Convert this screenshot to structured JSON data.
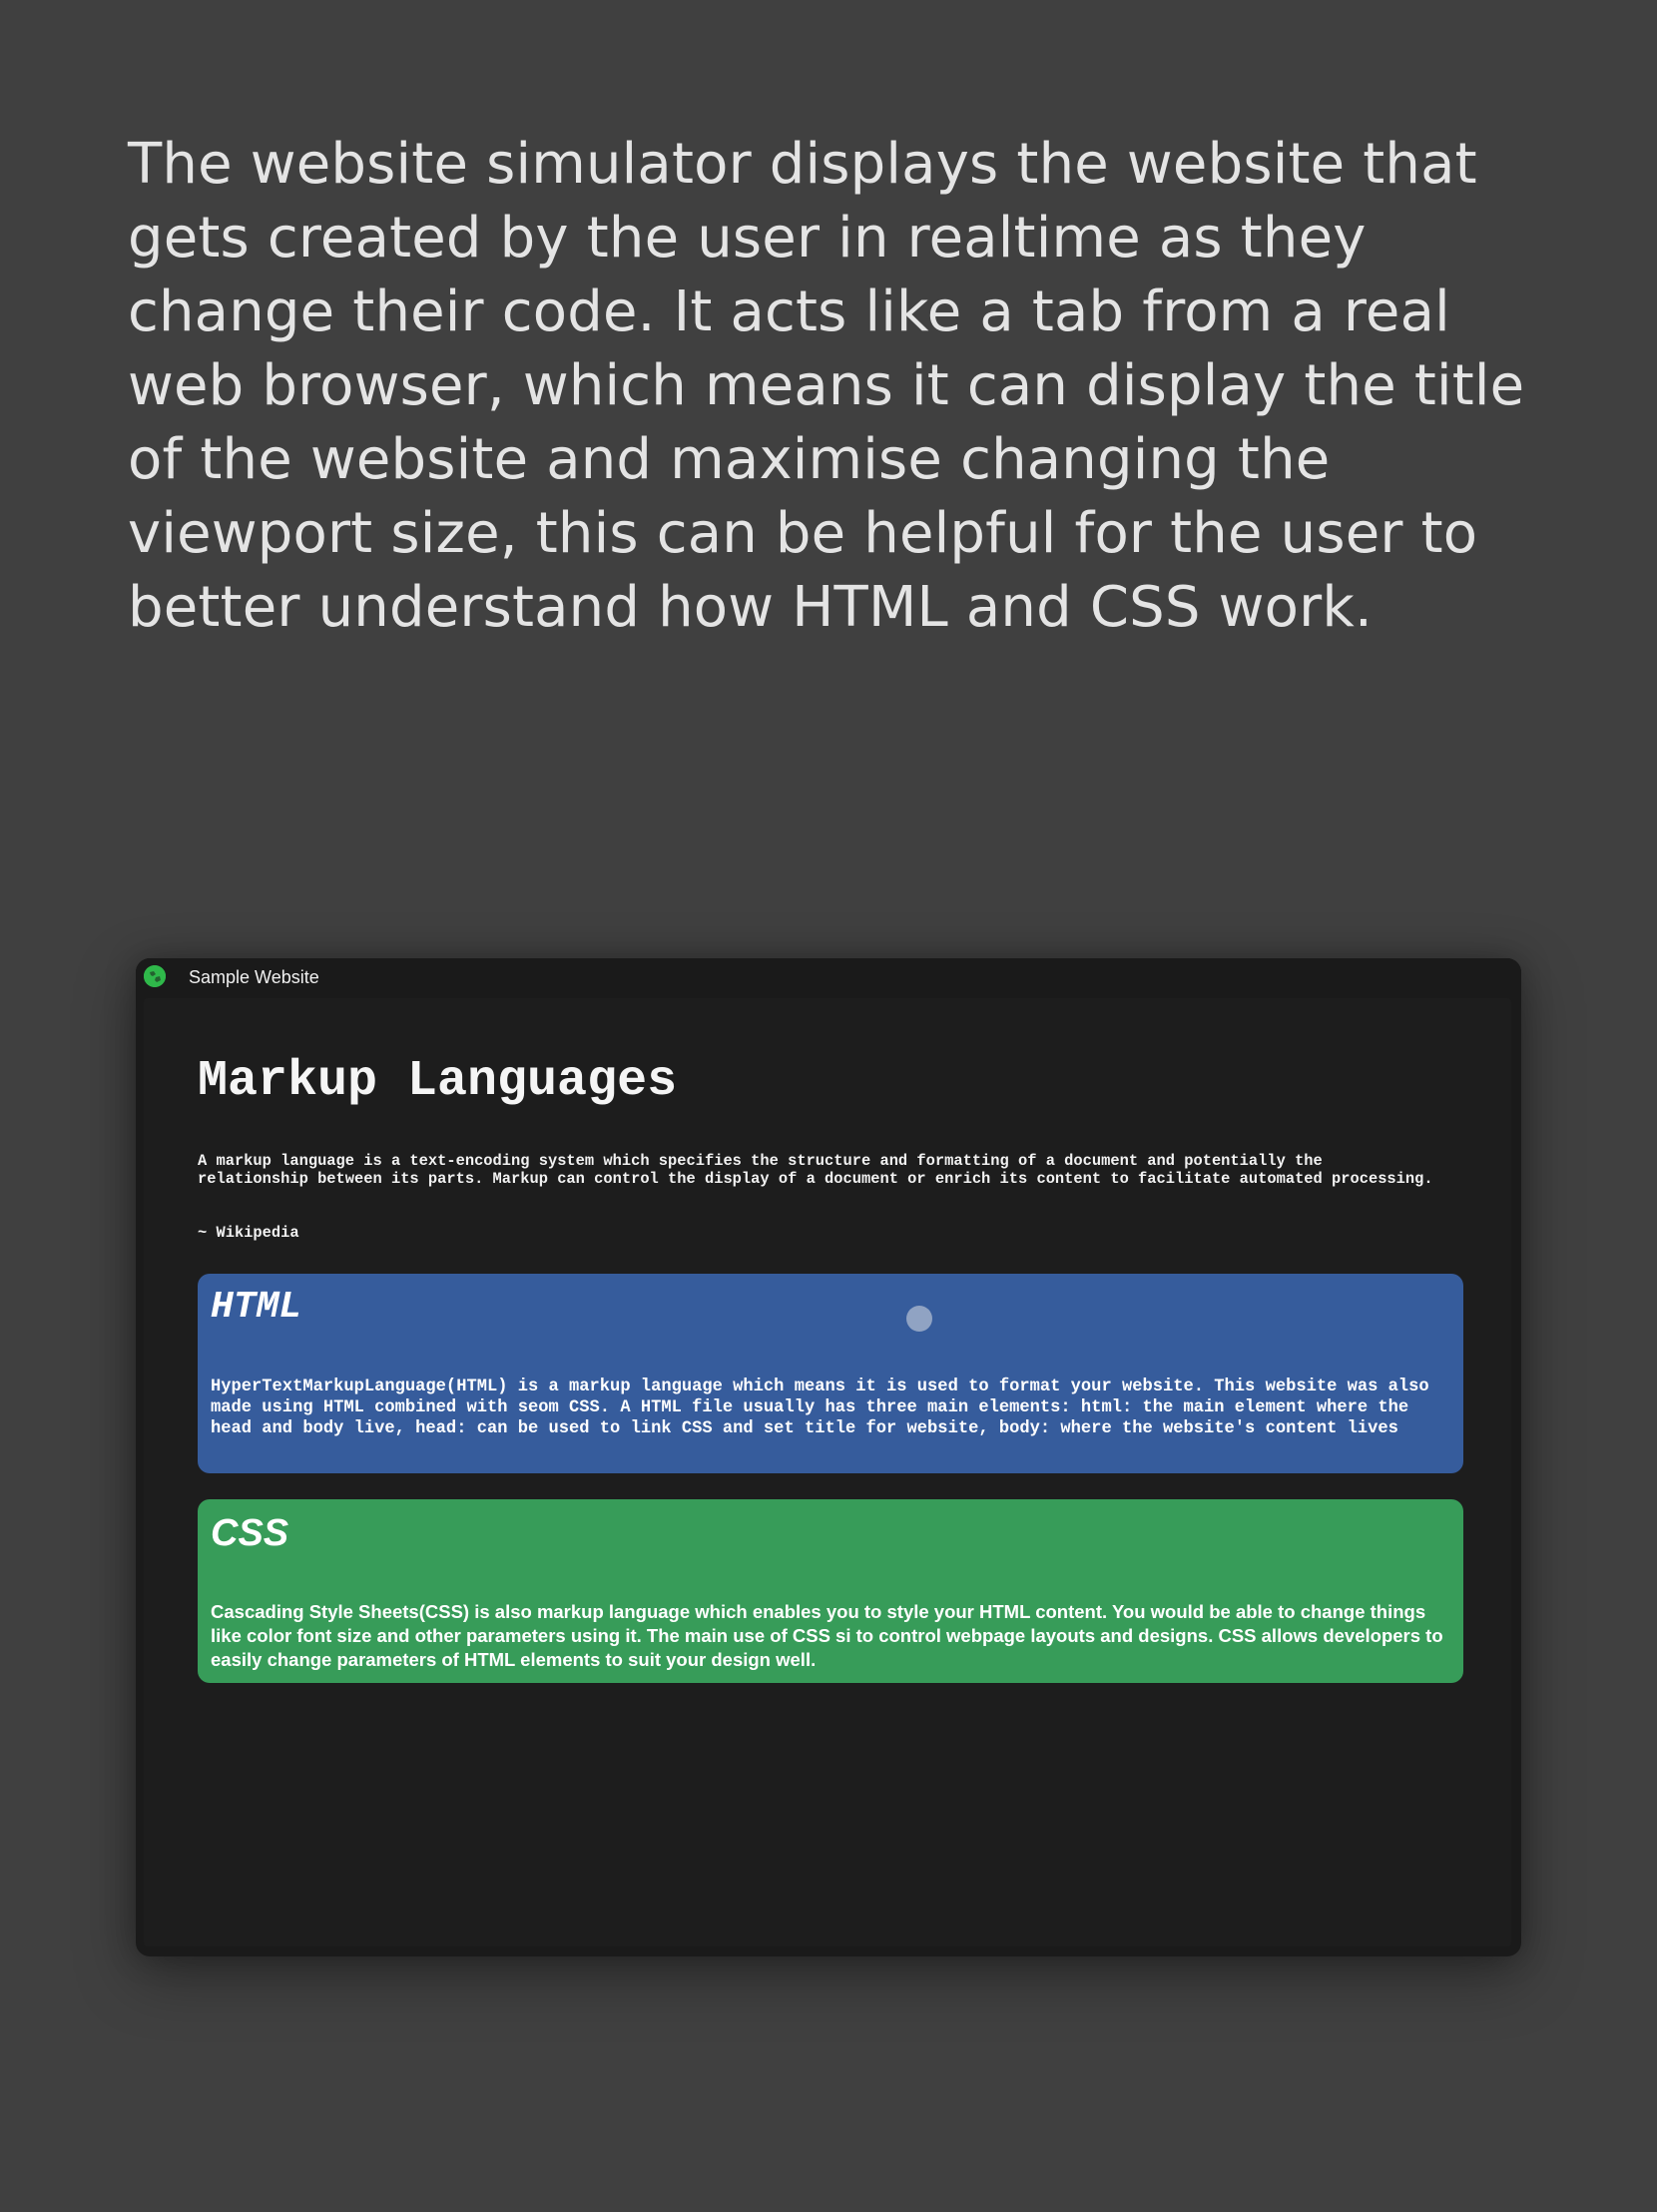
{
  "intro": {
    "text": "The website simulator displays the website that gets created by the user in realtime as they change their code. It acts like a tab from a real web browser, which means it can display the title of the website and maximise changing the viewport size, this can be helpful for the user to better understand how HTML and CSS work."
  },
  "simulator": {
    "tab": {
      "favicon": "globe-icon",
      "title": "Sample Website"
    },
    "page": {
      "heading": "Markup Languages",
      "intro": "A markup language is a text-encoding system which specifies the structure and formatting of a document and potentially the relationship between its parts. Markup can control the display of a document or enrich its content to facilitate automated processing.",
      "source": "~ Wikipedia",
      "cards": [
        {
          "title": "HTML",
          "body": "HyperTextMarkupLanguage(HTML) is a markup language which means it is used to format your website. This website was also made using HTML combined with seom CSS. A HTML file usually has three main elements: html: the main element where the head and body live, head: can be used to link CSS and set title for website, body: where the website's content lives",
          "color": "#365c9c"
        },
        {
          "title": "CSS",
          "body": "Cascading Style Sheets(CSS) is also markup language which enables you to style your HTML content. You would be able to change things like color font size and other parameters using it. The main use of CSS si to control webpage layouts and designs. CSS allows developers to easily change parameters of HTML elements to suit your design well.",
          "color": "#379c59"
        }
      ]
    }
  },
  "colors": {
    "background": "#404040",
    "window": "#1a1a1a",
    "viewport": "#1d1d1d",
    "favicon": "#2fb84a"
  }
}
